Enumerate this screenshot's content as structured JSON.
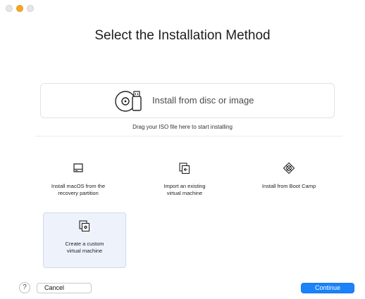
{
  "window": {
    "title": "Select the Installation Method",
    "traffic_lights": [
      "close",
      "minimize",
      "zoom"
    ]
  },
  "dropzone": {
    "label": "Install from disc or image",
    "hint": "Drag your ISO file here to start installing",
    "icon": "disc-and-usb-icon"
  },
  "options": [
    {
      "label": "Install macOS from the\nrecovery partition",
      "icon": "hard-drive-icon",
      "selected": false
    },
    {
      "label": "Import an existing\nvirtual machine",
      "icon": "import-vm-icon",
      "selected": false
    },
    {
      "label": "Install from Boot Camp",
      "icon": "boot-camp-icon",
      "selected": false
    },
    {
      "label": "Create a custom\nvirtual machine",
      "icon": "custom-vm-icon",
      "selected": true
    }
  ],
  "footer": {
    "help": "?",
    "cancel": "Cancel",
    "continue": "Continue"
  },
  "colors": {
    "accent": "#1a82fb",
    "selected_tile": "#eef3fb",
    "minimize": "#f5a623"
  }
}
